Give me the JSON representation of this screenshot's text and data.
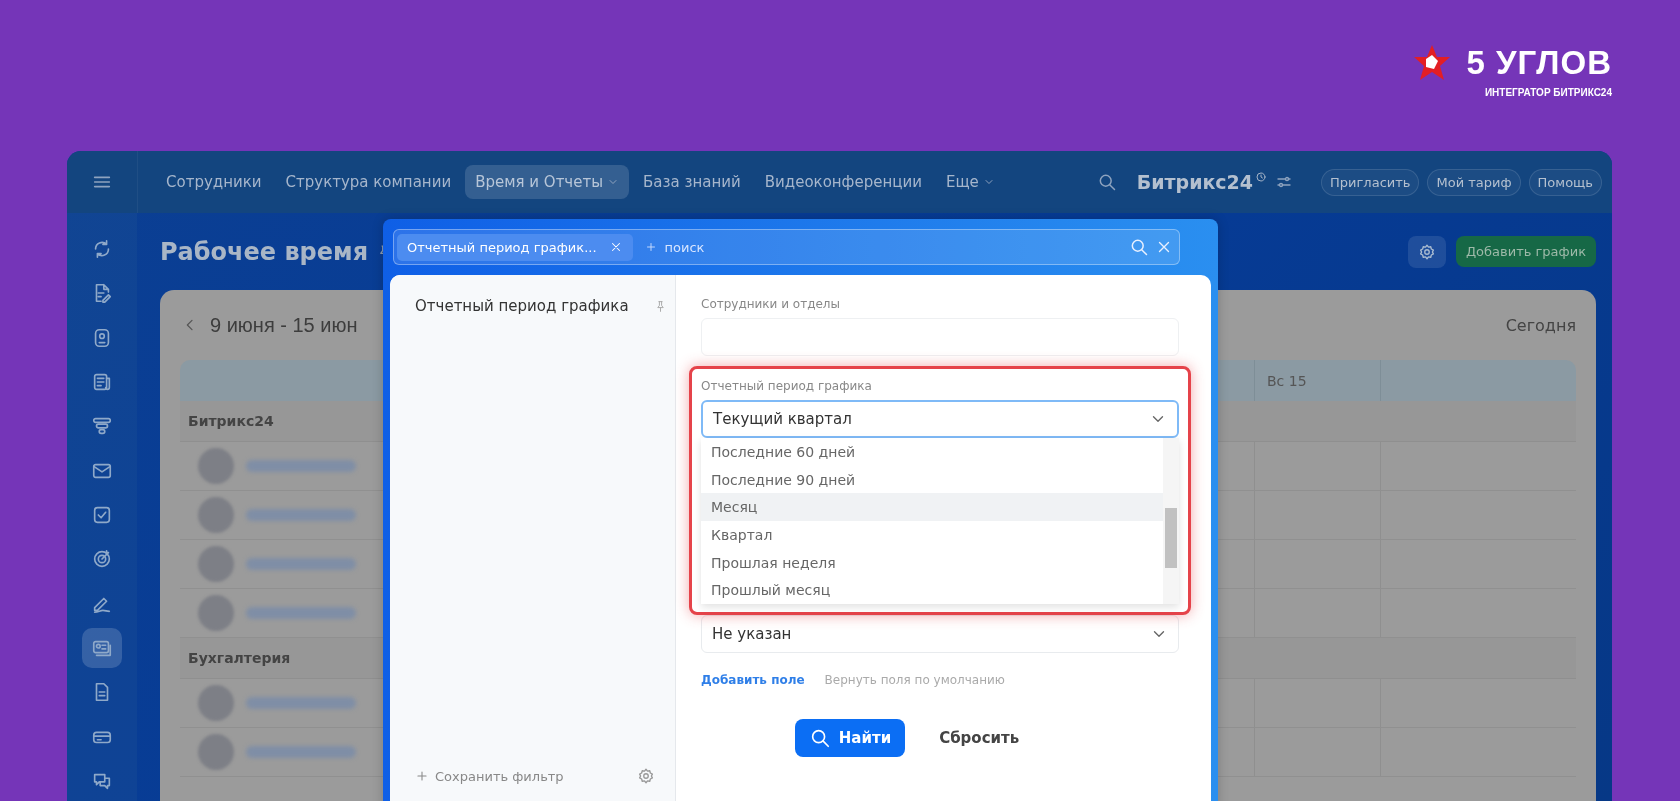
{
  "brand": {
    "name": "5 УГЛОВ",
    "tagline": "ИНТЕГРАТОР БИТРИКС24"
  },
  "nav": {
    "items": [
      {
        "label": "Сотрудники",
        "selected": false,
        "dropdown": false
      },
      {
        "label": "Структура компании",
        "selected": false,
        "dropdown": false
      },
      {
        "label": "Время и Отчеты",
        "selected": true,
        "dropdown": true
      },
      {
        "label": "База знаний",
        "selected": false,
        "dropdown": false
      },
      {
        "label": "Видеоконференции",
        "selected": false,
        "dropdown": false
      },
      {
        "label": "Еще",
        "selected": false,
        "dropdown": true
      }
    ],
    "product": "Битрикс24",
    "buttons": [
      "Пригласить",
      "Мой тариф",
      "Помощь"
    ]
  },
  "sidebar": {
    "items": [
      {
        "kind": "sync",
        "selected": false
      },
      {
        "kind": "doc-edit",
        "selected": false
      },
      {
        "kind": "drive",
        "selected": false
      },
      {
        "kind": "news",
        "selected": false
      },
      {
        "kind": "funnel",
        "selected": false
      },
      {
        "kind": "mail",
        "selected": false
      },
      {
        "kind": "task",
        "selected": false
      },
      {
        "kind": "target",
        "selected": false
      },
      {
        "kind": "pen",
        "selected": false
      },
      {
        "kind": "card",
        "selected": true
      },
      {
        "kind": "file",
        "selected": false
      },
      {
        "kind": "terminal",
        "selected": false
      },
      {
        "kind": "chat",
        "selected": false
      }
    ]
  },
  "page": {
    "title": "Рабочее время",
    "add_button": "Добавить график"
  },
  "calendar": {
    "range": "9 июня - 15 июн",
    "today": "Сегодня",
    "column": "Вс 15",
    "groups": [
      {
        "name": "Битрикс24",
        "members": [
          {
            "kind": "employee"
          },
          {
            "kind": "employee"
          },
          {
            "kind": "employee"
          },
          {
            "kind": "employee"
          }
        ]
      },
      {
        "name": "Бухгалтерия",
        "members": [
          {
            "kind": "employee"
          },
          {
            "kind": "employee"
          }
        ]
      }
    ]
  },
  "filter": {
    "chip": "Отчетный период график...",
    "search_placeholder": "поиск",
    "presets": [
      {
        "label": "Отчетный период графика",
        "selected": false
      }
    ],
    "save_filter": "Сохранить фильтр",
    "fields": [
      {
        "kind": "text",
        "label": "Сотрудники и отделы"
      },
      {
        "kind": "select",
        "label": "Отчетный период графика",
        "value": "Текущий квартал",
        "highlighted": true,
        "expanded": true,
        "options": [
          {
            "label": "Последние 60 дней",
            "selected": false
          },
          {
            "label": "Последние 90 дней",
            "selected": false
          },
          {
            "label": "Месяц",
            "selected": true
          },
          {
            "label": "Квартал",
            "selected": false
          },
          {
            "label": "Прошлая неделя",
            "selected": false
          },
          {
            "label": "Прошлый месяц",
            "selected": false
          }
        ]
      },
      {
        "kind": "select",
        "value": "Не указан",
        "highlighted": false,
        "expanded": false
      }
    ],
    "add_field": "Добавить поле",
    "restore_fields": "Вернуть поля по умолчанию",
    "find": "Найти",
    "reset": "Сбросить"
  }
}
